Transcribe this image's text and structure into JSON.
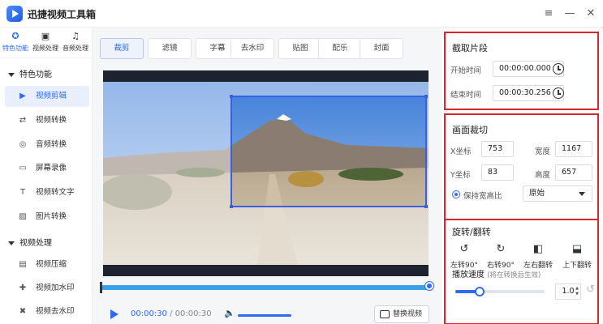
{
  "app": {
    "title": "迅捷视频工具箱"
  },
  "window": {
    "menu": "≡",
    "minimize": "—",
    "close": "✕"
  },
  "nav_tabs": [
    {
      "label": "特色功能",
      "icon": "star-icon",
      "glyph": "✪"
    },
    {
      "label": "视频处理",
      "icon": "film-icon",
      "glyph": "▣"
    },
    {
      "label": "音频处理",
      "icon": "music-icon",
      "glyph": "♫"
    }
  ],
  "sidebar": {
    "section1": "特色功能",
    "items1": [
      {
        "label": "视频剪辑",
        "icon": "video-edit-icon",
        "glyph": "▶",
        "active": true
      },
      {
        "label": "视频转换",
        "icon": "video-convert-icon",
        "glyph": "⇄"
      },
      {
        "label": "音频转换",
        "icon": "audio-convert-icon",
        "glyph": "◎"
      },
      {
        "label": "屏幕录像",
        "icon": "screen-record-icon",
        "glyph": "▭"
      },
      {
        "label": "视频转文字",
        "icon": "video-to-text-icon",
        "glyph": "T"
      },
      {
        "label": "图片转换",
        "icon": "image-convert-icon",
        "glyph": "▨"
      }
    ],
    "section2": "视频处理",
    "items2": [
      {
        "label": "视频压缩",
        "icon": "compress-icon",
        "glyph": "▤"
      },
      {
        "label": "视频加水印",
        "icon": "add-watermark-icon",
        "glyph": "✚"
      },
      {
        "label": "视频去水印",
        "icon": "remove-watermark-icon",
        "glyph": "✖"
      }
    ]
  },
  "tabs": [
    "裁剪",
    "滤镜",
    "字幕",
    "去水印",
    "贴图",
    "配乐",
    "封面"
  ],
  "player": {
    "current": "00:00:30",
    "sep": " / ",
    "total": "00:00:30",
    "replace": "替换视频",
    "volume": 1
  },
  "clip": {
    "title": "截取片段",
    "start_label": "开始时间",
    "start": "00:00:00.000",
    "end_label": "结束时间",
    "end": "00:00:30.256"
  },
  "crop": {
    "title": "画面裁切",
    "x_label": "X坐标",
    "x": "753",
    "w_label": "宽度",
    "w": "1167",
    "y_label": "Y坐标",
    "y": "83",
    "h_label": "高度",
    "h": "657",
    "ratio_label": "保持宽高比",
    "ratio_value": "原始"
  },
  "rotate": {
    "title": "旋转/翻转",
    "buttons": [
      {
        "label": "左转90°",
        "icon": "rotate-left-icon",
        "glyph": "↺"
      },
      {
        "label": "右转90°",
        "icon": "rotate-right-icon",
        "glyph": "↻"
      },
      {
        "label": "左右翻转",
        "icon": "flip-horizontal-icon",
        "glyph": "◧"
      },
      {
        "label": "上下翻转",
        "icon": "flip-vertical-icon",
        "glyph": "⬓"
      }
    ],
    "speed_label": "播放速度",
    "speed_hint": "(将在转换后生效)",
    "speed_value": "1.0",
    "speed_fraction": 0.27
  },
  "colors": {
    "accent": "#2e6bf0",
    "highlight": "#d9262c"
  }
}
